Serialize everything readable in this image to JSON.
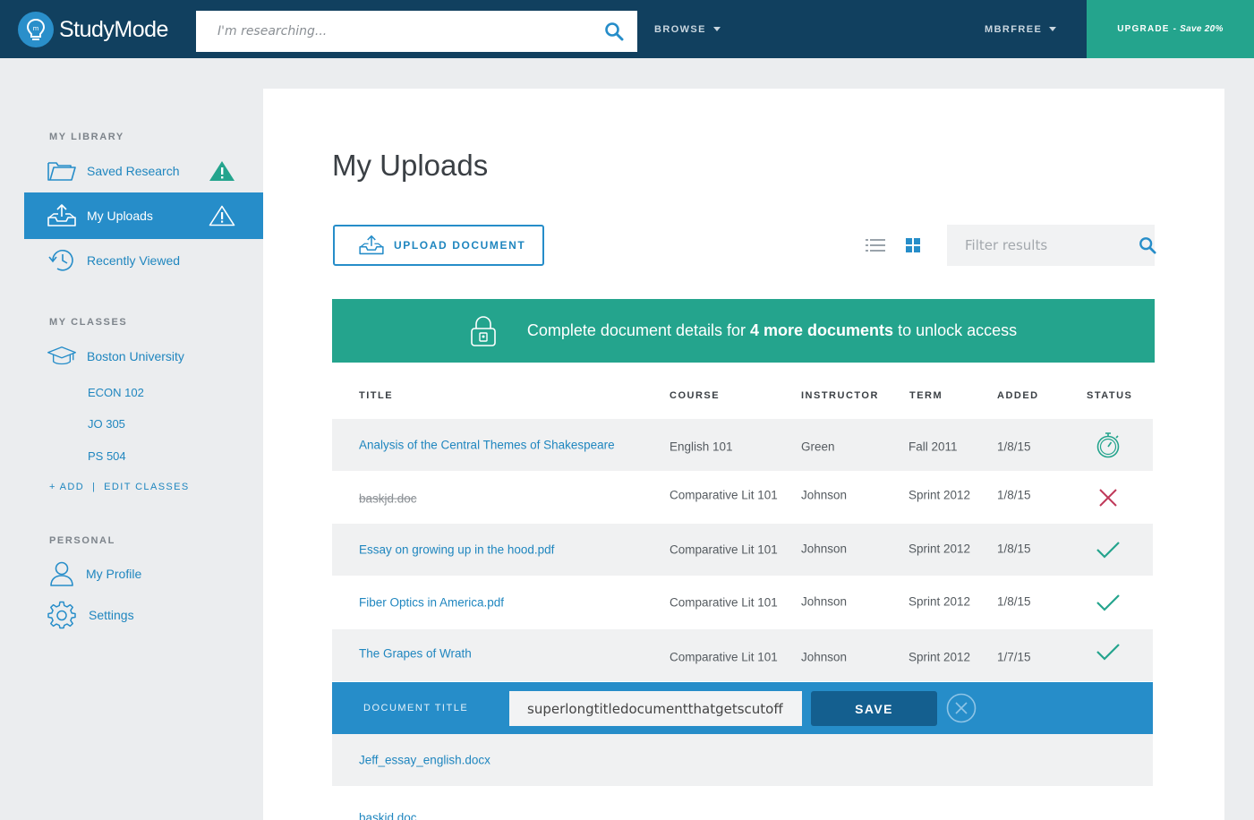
{
  "header": {
    "logo_text": "StudyMode",
    "search_placeholder": "I'm researching...",
    "browse_label": "BROWSE",
    "user_label": "MBRFREE",
    "upgrade_label": "UPGRADE -",
    "upgrade_promo": "Save 20%"
  },
  "sidebar": {
    "library_heading": "MY LIBRARY",
    "library_items": [
      {
        "label": "Saved Research"
      },
      {
        "label": "My Uploads"
      },
      {
        "label": "Recently Viewed"
      }
    ],
    "classes_heading": "MY CLASSES",
    "school": "Boston University",
    "classes": [
      "ECON 102",
      "JO 305",
      "PS 504"
    ],
    "add_edit_label": "+ ADD  |  EDIT CLASSES",
    "personal_heading": "PERSONAL",
    "personal_items": [
      {
        "label": "My Profile"
      },
      {
        "label": "Settings"
      }
    ]
  },
  "main": {
    "title": "My Uploads",
    "upload_button": "UPLOAD DOCUMENT",
    "filter_placeholder": "Filter results",
    "banner": {
      "prefix": "Complete document details for ",
      "bold": "4 more documents",
      "suffix": " to unlock access"
    },
    "columns": [
      "TITLE",
      "COURSE",
      "INSTRUCTOR",
      "TERM",
      "ADDED",
      "STATUS"
    ],
    "rows": [
      {
        "title": "Analysis of the Central Themes of Shakespeare",
        "course": "English 101",
        "instructor": "Green",
        "term": "Fall 2011",
        "added": "1/8/15",
        "status": "pending"
      },
      {
        "title": "baskjd.doc",
        "course": "Comparative Lit 101",
        "instructor": "Johnson",
        "term": "Sprint 2012",
        "added": "1/8/15",
        "status": "rejected"
      },
      {
        "title": "Essay on growing up in the hood.pdf",
        "course": "Comparative Lit 101",
        "instructor": "Johnson",
        "term": "Sprint 2012",
        "added": "1/8/15",
        "status": "approved"
      },
      {
        "title": "Fiber Optics in America.pdf",
        "course": "Comparative Lit 101",
        "instructor": "Johnson",
        "term": "Sprint 2012",
        "added": "1/8/15",
        "status": "approved"
      },
      {
        "title": "The Grapes of Wrath",
        "course": "Comparative Lit 101",
        "instructor": "Johnson",
        "term": "Sprint 2012",
        "added": "1/7/15",
        "status": "approved"
      }
    ],
    "edit_row": {
      "label": "DOCUMENT TITLE",
      "value": "superlongtitledocumentthatgetscutoff.xls",
      "save_label": "SAVE"
    },
    "incomplete_rows": [
      {
        "title": "Jeff_essay_english.docx"
      },
      {
        "title": "baskjd.doc"
      }
    ],
    "colors": {
      "navy": "#11405f",
      "teal": "#24a48d",
      "blue": "#268dc9",
      "link": "#1f86bf",
      "reject": "#c0395a"
    }
  }
}
